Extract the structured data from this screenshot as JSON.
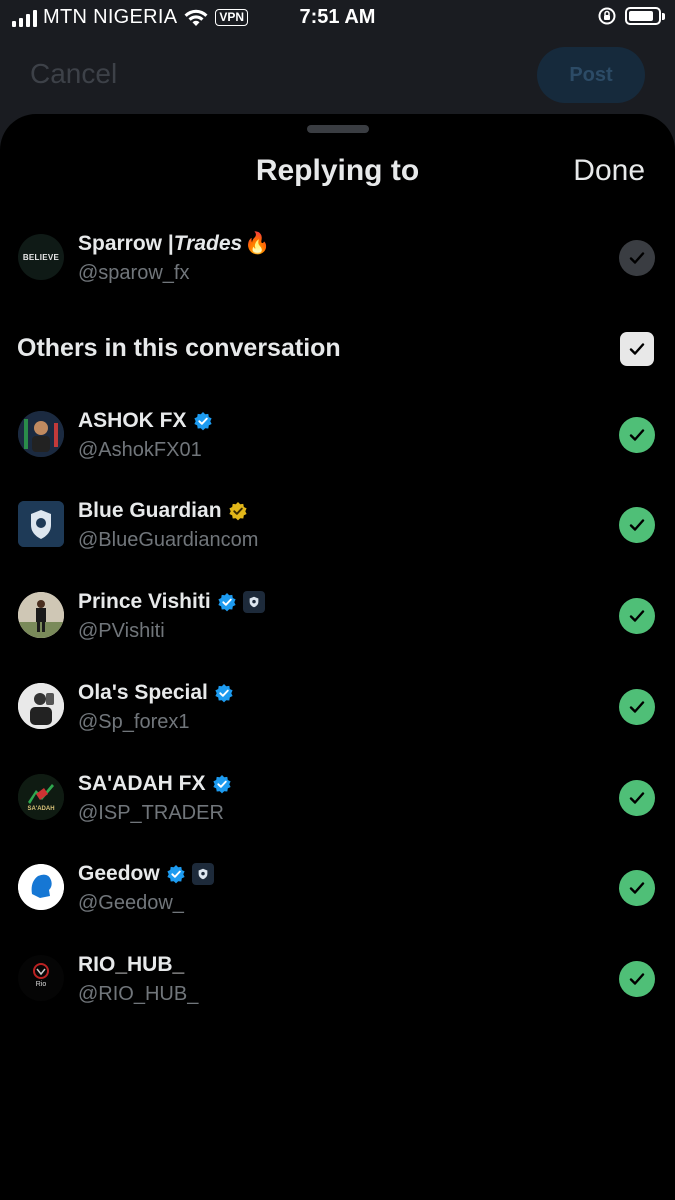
{
  "status": {
    "carrier": "MTN NIGERIA",
    "vpn": "VPN",
    "time": "7:51 AM"
  },
  "composer": {
    "cancel_label": "Cancel",
    "post_label": "Post"
  },
  "sheet": {
    "title": "Replying to",
    "done_label": "Done"
  },
  "primary": {
    "name": "Sparrow | ",
    "name_italic": "Trades",
    "emoji": "🔥",
    "handle": "@sparow_fx",
    "avatar_text": "BELIEVE"
  },
  "others": {
    "label": "Others in this conversation",
    "users": [
      {
        "name": "ASHOK FX",
        "handle": "@AshokFX01",
        "badge": "verified-blue"
      },
      {
        "name": "Blue Guardian",
        "handle": "@BlueGuardiancom",
        "badge": "verified-gold"
      },
      {
        "name": "Prince Vishiti",
        "handle": "@PVishiti",
        "badge": "verified-blue"
      },
      {
        "name": "Ola's Special",
        "handle": "@Sp_forex1",
        "badge": "verified-blue"
      },
      {
        "name": "SA'ADAH FX",
        "handle": "@ISP_TRADER",
        "badge": "verified-blue",
        "avatar_text": "SA'ADAH"
      },
      {
        "name": "Geedow",
        "handle": "@Geedow_",
        "badge": "verified-blue"
      },
      {
        "name": "RIO_HUB_",
        "handle": "@RIO_HUB_",
        "badge": "none",
        "avatar_text": "Rio"
      }
    ]
  },
  "colors": {
    "check_green": "#4fbf77",
    "verified_blue": "#1d9bf0",
    "verified_gold": "#e2b719"
  }
}
